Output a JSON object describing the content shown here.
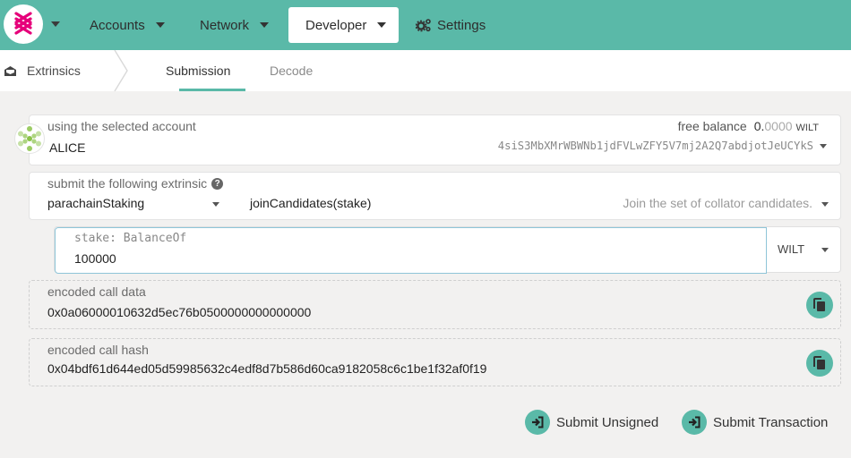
{
  "nav": {
    "items": [
      {
        "label": "Accounts"
      },
      {
        "label": "Network"
      },
      {
        "label": "Developer"
      },
      {
        "label": "Settings"
      }
    ]
  },
  "subnav": {
    "section": "Extrinsics",
    "tabs": [
      {
        "label": "Submission"
      },
      {
        "label": "Decode"
      }
    ]
  },
  "account": {
    "label": "using the selected account",
    "name": "ALICE",
    "balance_label": "free balance",
    "balance_whole": "0.",
    "balance_decimals": "0000",
    "balance_unit": "WILT",
    "address": "4siS3MbXMrWBWNb1jdFVLwZFY5V7mj2A2Q7abdjotJeUCYkS"
  },
  "extrinsic": {
    "label": "submit the following extrinsic",
    "module": "parachainStaking",
    "method": "joinCandidates(stake)",
    "description": "Join the set of collator candidates."
  },
  "param": {
    "label": "stake: BalanceOf",
    "value": "100000",
    "unit": "WILT"
  },
  "encoded_call": {
    "label": "encoded call data",
    "value": "0x0a06000010632d5ec76b0500000000000000"
  },
  "encoded_hash": {
    "label": "encoded call hash",
    "value": "0x04bdf61d644ed05d59985632c4edf8d7b586d60ca9182058c6c1be1f32af0f19"
  },
  "actions": {
    "unsigned": "Submit Unsigned",
    "transaction": "Submit Transaction"
  },
  "colors": {
    "accent": "#5ab9a8"
  }
}
